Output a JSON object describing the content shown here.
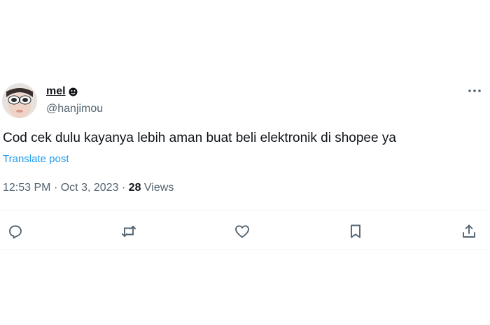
{
  "author": {
    "display_name": "mel",
    "badge_icon": "smiley-face-icon",
    "handle": "@hanjimou"
  },
  "post": {
    "text": "Cod cek dulu kayanya lebih aman buat beli elektronik di shopee ya",
    "translate_label": "Translate post"
  },
  "meta": {
    "time": "12:53 PM",
    "separator": "·",
    "date": "Oct 3, 2023",
    "views_count": "28",
    "views_label": "Views"
  },
  "actions": [
    {
      "icon": "reply-icon"
    },
    {
      "icon": "repost-icon"
    },
    {
      "icon": "heart-icon"
    },
    {
      "icon": "bookmark-icon"
    },
    {
      "icon": "share-icon"
    }
  ],
  "colors": {
    "text": "#0f1419",
    "secondary": "#536471",
    "link": "#1d9bf0",
    "divider": "#eff3f4"
  }
}
